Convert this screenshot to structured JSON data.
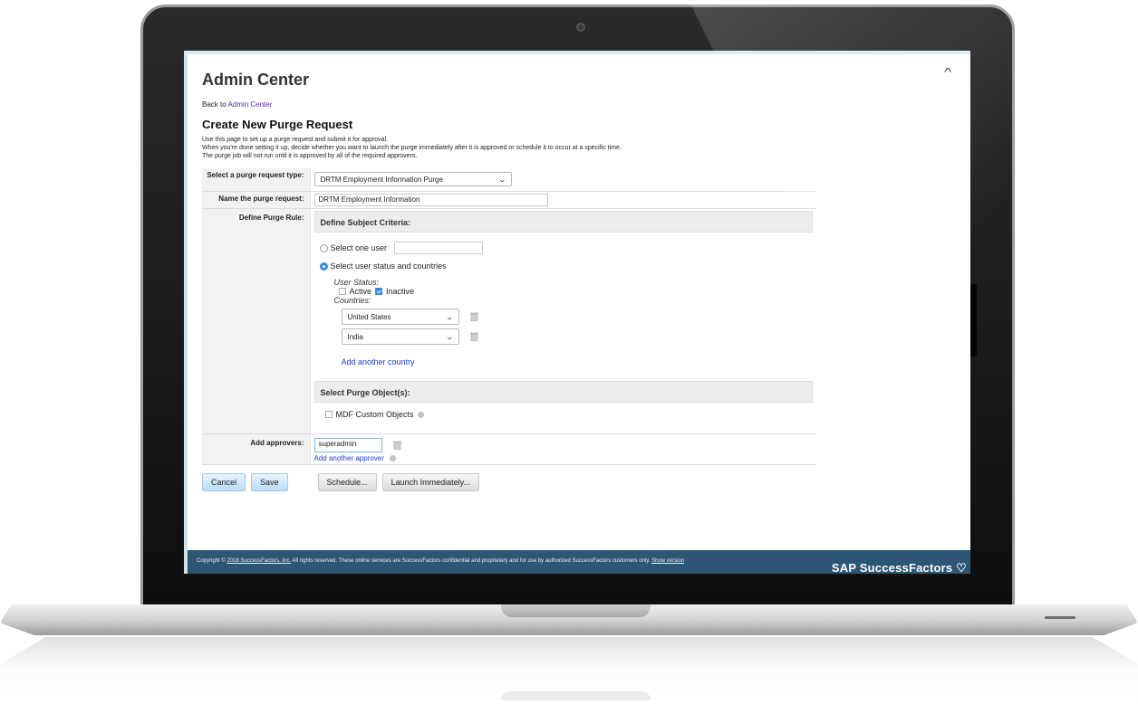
{
  "app": {
    "title": "Admin Center",
    "back_prefix": "Back to ",
    "back_link": "Admin Center",
    "scroll_up": "^"
  },
  "page": {
    "heading": "Create New Purge Request",
    "description": [
      "Use this page to set up a purge request and submit it for approval.",
      "When you're done setting it up, decide whether you want to launch the purge immediately after it is approved or schedule it to occur at a specific time.",
      "The purge job will not run until it is approved by all of the required approvers."
    ]
  },
  "form": {
    "type_label": "Select a purge request type:",
    "type_value": "DRTM Employment Information Purge",
    "name_label": "Name the purge request:",
    "name_value": "DRTM Employment Information",
    "rule_label": "Define Purge Rule:",
    "subject_section": "Define Subject Criteria:",
    "option_one_user": "Select one user",
    "option_status_countries": "Select user status and countries",
    "user_status_label": "User Status:",
    "status_active": "Active",
    "status_inactive": "Inactive",
    "countries_label": "Countries:",
    "countries": [
      "United States",
      "India"
    ],
    "add_country": "Add another country",
    "objects_section": "Select Purge Object(s):",
    "object_mdf": "MDF Custom Objects",
    "approvers_label": "Add approvers:",
    "approver_value": "superadmin",
    "add_approver": "Add another approver"
  },
  "buttons": {
    "cancel": "Cancel",
    "save": "Save",
    "schedule": "Schedule...",
    "launch": "Launch Immediately..."
  },
  "footer": {
    "prefix": "Copyright © ",
    "copyright_link": "2018 SuccessFactors, Inc.",
    "text": " All rights reserved. These online services are SuccessFactors confidential and proprietary and for use by authorized SuccessFactors customers only. ",
    "show_version": "Show version",
    "brand": "SAP SuccessFactors"
  },
  "colors": {
    "footer_bg": "#2d5675",
    "link_blue": "#1d3ed3",
    "checkbox_blue": "#2a8cf0"
  }
}
